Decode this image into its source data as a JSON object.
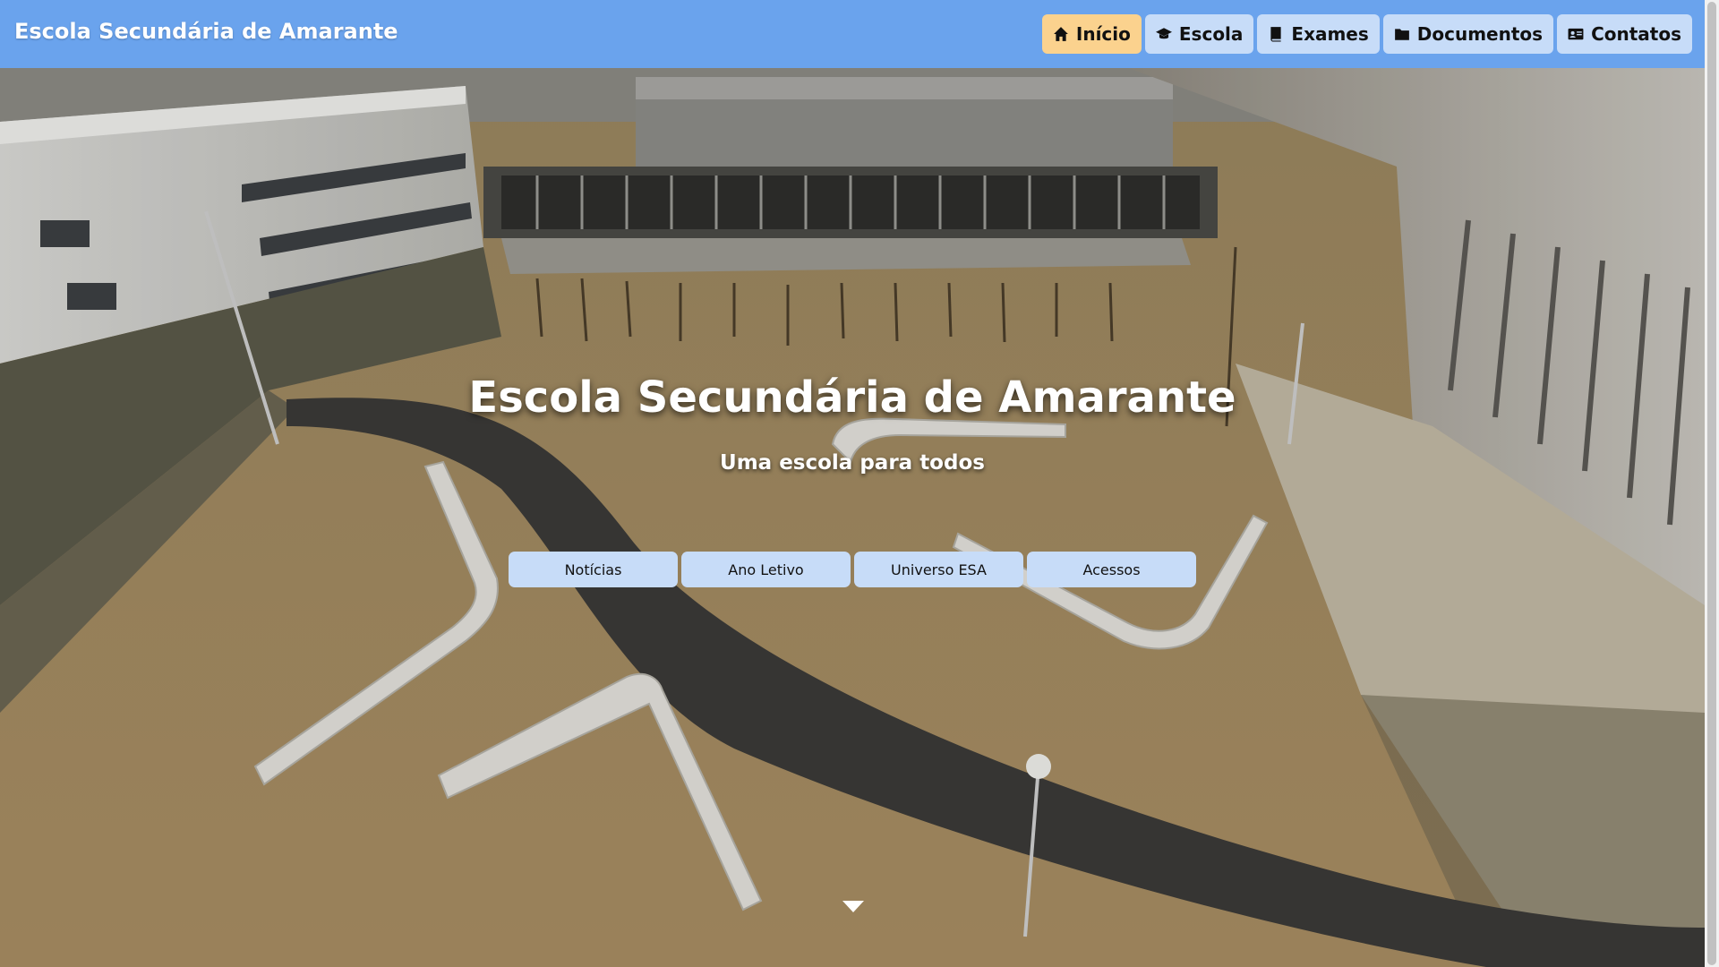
{
  "brand": {
    "title": "Escola Secundária de Amarante"
  },
  "nav": {
    "items": [
      {
        "label": "Início",
        "icon": "home-icon",
        "active": true
      },
      {
        "label": "Escola",
        "icon": "graduation-cap-icon"
      },
      {
        "label": "Exames",
        "icon": "book-icon"
      },
      {
        "label": "Documentos",
        "icon": "folder-icon"
      },
      {
        "label": "Contatos",
        "icon": "address-card-icon"
      }
    ]
  },
  "hero": {
    "title": "Escola Secundária de Amarante",
    "subtitle": "Uma escola para todos",
    "buttons": [
      "Notícias",
      "Ano Letivo",
      "Universo ESA",
      "Acessos"
    ],
    "scroll_icon": "chevron-down-icon"
  },
  "colors": {
    "navbar": "#6aa3ed",
    "nav_button": "#c7dcf8",
    "nav_active": "#fbd28e",
    "hero_button": "#c7dcf8"
  }
}
